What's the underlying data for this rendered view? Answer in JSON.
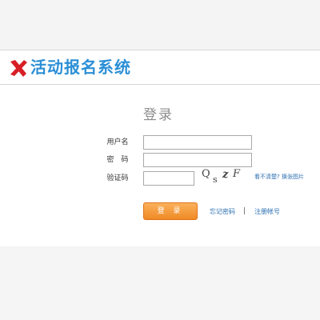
{
  "header": {
    "logo_text": "活动报名系统",
    "logo_icon": "x-mark-icon",
    "logo_color": "#d71f26",
    "title_color": "#2b8fd6"
  },
  "login": {
    "title": "登录",
    "username_label": "用户名",
    "password_label": "密　码",
    "captcha_label": "验证码",
    "username_value": "",
    "password_value": "",
    "captcha_value": "",
    "captcha_image_text": [
      "Q",
      "s",
      "z",
      "F"
    ],
    "refresh_link": "看不清楚? 换张图片",
    "submit_label": "登 录",
    "forgot_link": "忘记密码",
    "separator": "|",
    "register_link": "注册帐号",
    "button_color": "#ef8a26",
    "link_color": "#2b6fb0"
  }
}
